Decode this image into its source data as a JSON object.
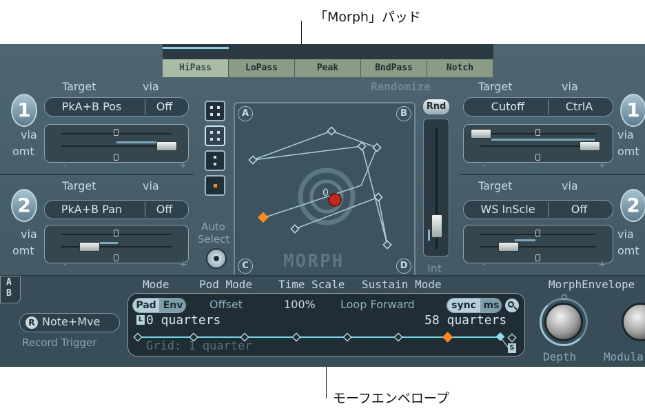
{
  "callouts": {
    "top": "「Morph」パッド",
    "bottom": "モーフエンベロープ"
  },
  "tabs": [
    "HiPass",
    "LoPass",
    "Peak",
    "BndPass",
    "Notch"
  ],
  "randomize": "Randomize",
  "rnd_button": "Rnd",
  "int_label": "Int",
  "morph_label": "MORPH",
  "corners": [
    "A",
    "B",
    "C",
    "D"
  ],
  "center_label": "0",
  "auto_select": [
    "Auto",
    "Select"
  ],
  "ab_toggle": [
    "A",
    "B"
  ],
  "left_mod": [
    {
      "number": "1",
      "target_hdr": "Target",
      "via_hdr": "via",
      "target": "PkA+B Pos",
      "via": "Off",
      "via_side": "via",
      "amt_side": "omt",
      "minus": "-",
      "plus": "+"
    },
    {
      "number": "2",
      "target_hdr": "Target",
      "via_hdr": "via",
      "target": "PkA+B Pan",
      "via": "Off",
      "via_side": "via",
      "amt_side": "omt",
      "minus": "-",
      "plus": "+"
    }
  ],
  "right_mod": [
    {
      "number": "1",
      "target_hdr": "Target",
      "via_hdr": "via",
      "target": "Cutoff",
      "via": "CtrlA",
      "via_side": "via",
      "amt_side": "omt",
      "minus": "-",
      "plus": "+"
    },
    {
      "number": "2",
      "target_hdr": "Target",
      "via_hdr": "via",
      "target": "WS InScle",
      "via": "Off",
      "via_side": "via",
      "amt_side": "omt",
      "minus": "-",
      "plus": "+"
    }
  ],
  "mode_row": {
    "mode": "Mode",
    "pod_mode": "Pod Mode",
    "time_scale": "Time Scale",
    "sustain_mode": "Sustain Mode",
    "morph_envelope": "MorphEnvelope"
  },
  "record": {
    "r_badge": "R",
    "button": "Note+Mve",
    "label": "Record Trigger"
  },
  "envelope": {
    "pad": "Pad",
    "env": "Env",
    "offset": "Offset",
    "time_scale_value": "100%",
    "sustain_value": "Loop Forward",
    "sync": "sync",
    "ms": "ms",
    "l_marker": "L",
    "s_marker": "S",
    "start": "0 quarters",
    "end": "58 quarters",
    "grid": "Grid: 1 quarter"
  },
  "knobs": {
    "depth": "Depth",
    "modulation": "Modula"
  }
}
